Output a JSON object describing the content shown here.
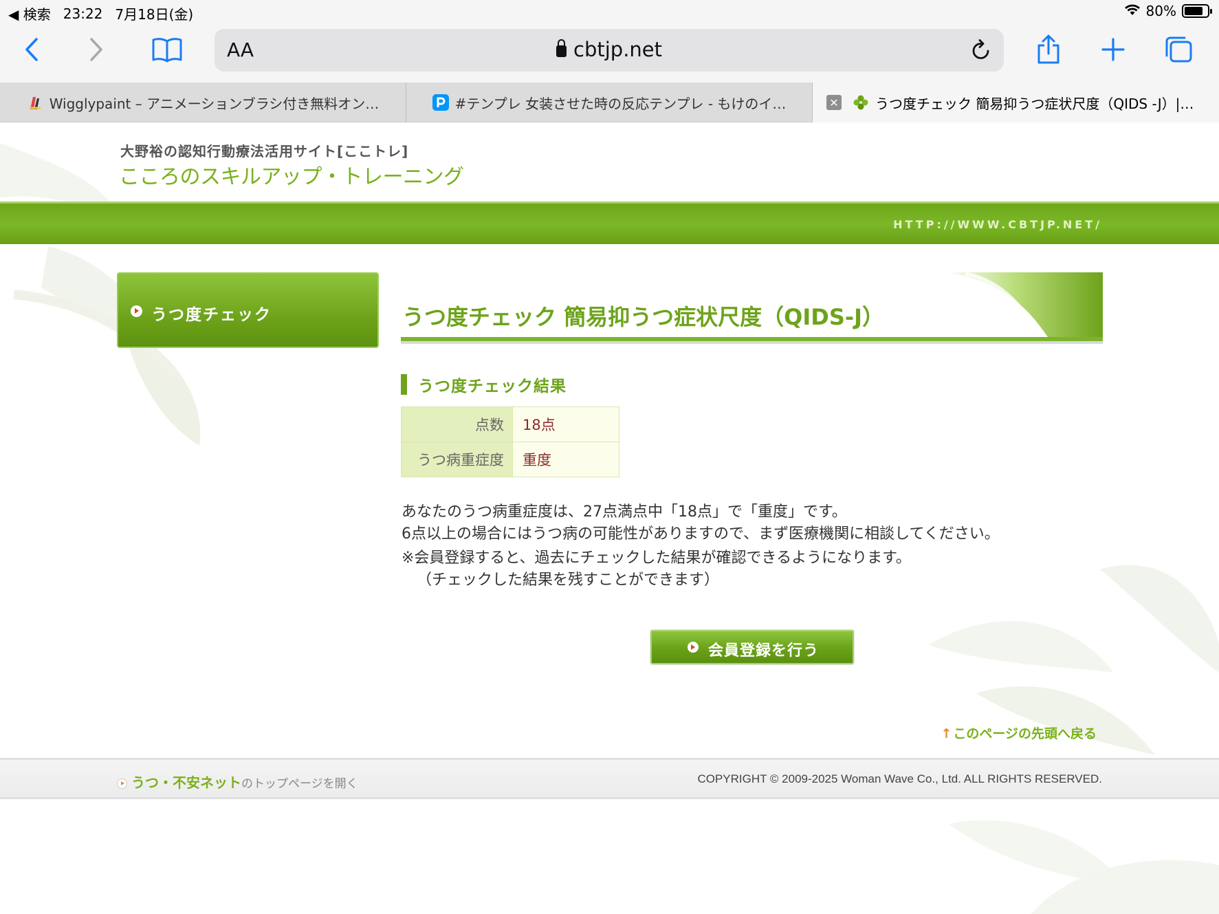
{
  "status_bar": {
    "back_label": "◀ 検索",
    "time": "23:22",
    "date": "7月18日(金)",
    "battery": "80%",
    "battery_level": 0.8
  },
  "browser": {
    "aa_label": "AA",
    "domain": "cbtjp.net",
    "accent_color": "#1a7cf5"
  },
  "tabs": [
    {
      "title": "Wigglypaint – アニメーションブラシ付き無料オン…"
    },
    {
      "title": "#テンプレ 女装させた時の反応テンプレ - もけのイ…"
    },
    {
      "title": "うつ度チェック 簡易抑うつ症状尺度（QIDS -J）|…",
      "active": true
    }
  ],
  "site": {
    "subtitle": "大野裕の認知行動療法活用サイト[ここトレ]",
    "title": "こころのスキルアップ・トレーニング",
    "url_banner": "HTTP://WWW.CBTJP.NET/",
    "brand_color": "#6ea31b"
  },
  "sidebar": {
    "items": [
      {
        "label": "うつ度チェック"
      }
    ]
  },
  "main": {
    "page_title": "うつ度チェック 簡易抑うつ症状尺度（QIDS-J）",
    "section_title": "うつ度チェック結果",
    "result_table": [
      {
        "label": "点数",
        "value": "18点"
      },
      {
        "label": "うつ病重症度",
        "value": "重度"
      }
    ],
    "message_lines": [
      "あなたのうつ病重症度は、27点満点中「18点」で「重度」です。",
      "6点以上の場合にはうつ病の可能性がありますので、まず医療機関に相談してください。"
    ],
    "note_lines": [
      "※会員登録すると、過去にチェックした結果が確認できるようになります。",
      "（チェックした結果を残すことができます）"
    ],
    "register_button": "会員登録を行う",
    "back_to_top": "このページの先頭へ戻る"
  },
  "footer": {
    "link_main": "うつ・不安ネット",
    "link_rest": "のトップページを開く",
    "copyright": "COPYRIGHT © 2009-2025 Woman Wave Co., Ltd. ALL RIGHTS RESERVED."
  }
}
